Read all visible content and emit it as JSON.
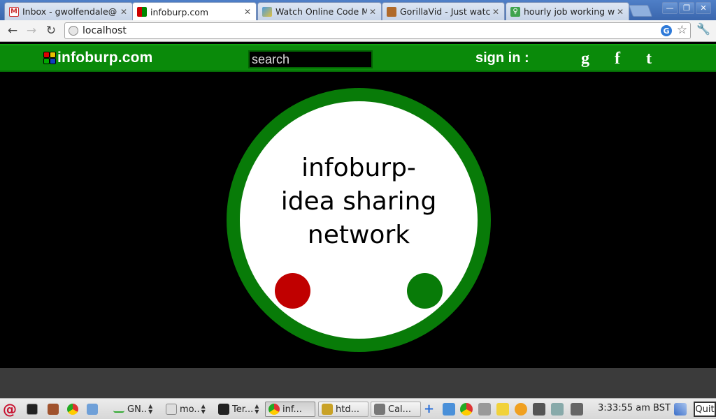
{
  "browser": {
    "tabs": [
      {
        "title": "Inbox - gwolfendale@",
        "favicon": "gmail-icon",
        "active": false
      },
      {
        "title": "infoburp.com",
        "favicon": "infoburp-icon",
        "active": true
      },
      {
        "title": "Watch Online Code M",
        "favicon": "site-icon",
        "active": false
      },
      {
        "title": "GorillaVid - Just watc",
        "favicon": "gorilla-icon",
        "active": false
      },
      {
        "title": "hourly job working w",
        "favicon": "job-icon",
        "active": false
      }
    ],
    "close_glyph": "✕",
    "url": "localhost"
  },
  "site": {
    "logo_text": "infoburp.com",
    "search_placeholder": "search",
    "signin_label": "sign in :",
    "social": {
      "google": "g",
      "facebook": "f",
      "tumblr": "t"
    },
    "headline": [
      "infoburp-",
      "idea sharing",
      "network"
    ],
    "colors": {
      "green": "#087b08",
      "bar_green": "#0a8a0a",
      "red_dot": "#c00000",
      "green_dot": "#087b08"
    }
  },
  "taskbar": {
    "items": [
      {
        "label": "GN..",
        "type": "widget"
      },
      {
        "label": "mo..",
        "type": "widget"
      },
      {
        "label": "Ter...",
        "type": "widget"
      },
      {
        "label": "inf...",
        "type": "task",
        "active": true
      },
      {
        "label": "htd...",
        "type": "task"
      },
      {
        "label": "Cal...",
        "type": "task"
      }
    ],
    "clock": "3:33:55 am BST",
    "quit_label": "Quit"
  }
}
